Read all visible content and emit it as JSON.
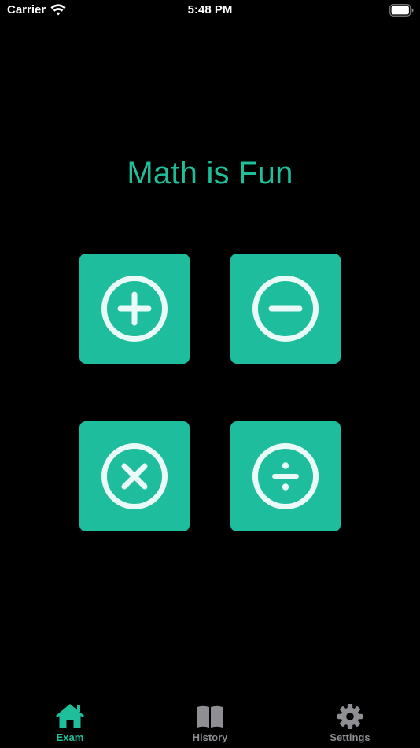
{
  "status_bar": {
    "carrier": "Carrier",
    "time": "5:48 PM"
  },
  "title": "Math is Fun",
  "colors": {
    "accent": "#1fbf9c",
    "tile": "#1dbd9e",
    "icon_fg": "#eafaf6",
    "tab_inactive": "#8e8e93",
    "background": "#000000"
  },
  "operations": [
    {
      "name": "addition",
      "icon": "plus-circle-icon"
    },
    {
      "name": "subtraction",
      "icon": "minus-circle-icon"
    },
    {
      "name": "multiplication",
      "icon": "times-circle-icon"
    },
    {
      "name": "division",
      "icon": "divide-circle-icon"
    }
  ],
  "tabs": [
    {
      "label": "Exam",
      "icon": "home-icon",
      "active": true
    },
    {
      "label": "History",
      "icon": "book-icon",
      "active": false
    },
    {
      "label": "Settings",
      "icon": "gear-icon",
      "active": false
    }
  ]
}
